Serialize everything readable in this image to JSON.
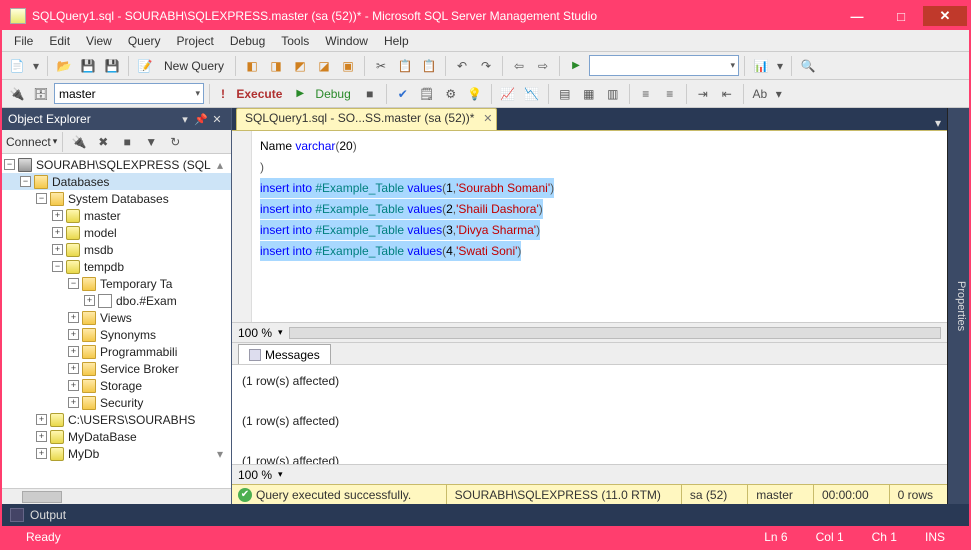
{
  "window": {
    "title": "SQLQuery1.sql - SOURABH\\SQLEXPRESS.master (sa (52))* - Microsoft SQL Server Management Studio"
  },
  "menu": [
    "File",
    "Edit",
    "View",
    "Query",
    "Project",
    "Debug",
    "Tools",
    "Window",
    "Help"
  ],
  "toolbar1": {
    "new_query": "New Query"
  },
  "toolbar2": {
    "db_selector": "master",
    "execute": "Execute",
    "debug": "Debug"
  },
  "object_explorer": {
    "title": "Object Explorer",
    "connect": "Connect",
    "nodes": {
      "server": "SOURABH\\SQLEXPRESS (SQL",
      "databases": "Databases",
      "system_db": "System Databases",
      "master": "master",
      "model": "model",
      "msdb": "msdb",
      "tempdb": "tempdb",
      "temp_tables": "Temporary Ta",
      "example": "dbo.#Exam",
      "views": "Views",
      "synonyms": "Synonyms",
      "programmability": "Programmabili",
      "service_broker": "Service Broker",
      "storage": "Storage",
      "security": "Security",
      "users_path": "C:\\USERS\\SOURABHS",
      "mydatabase": "MyDataBase",
      "mydb": "MyDb"
    }
  },
  "editor": {
    "tab_label": "SQLQuery1.sql - SO...SS.master (sa (52))*",
    "code": {
      "line1_a": "Name ",
      "line1_b": "varchar",
      "line1_c": "(",
      "line1_d": "20",
      "line1_e": ")",
      "line2": ")",
      "ins_kw": "insert into",
      "ins_tab": " #Example_Table ",
      "ins_values": "values",
      "row1_open": "(",
      "row1_n": "1",
      "row1_c": ",",
      "row1_s": "'Sourabh Somani'",
      "row1_close": ")",
      "row2_n": "2",
      "row2_s": "'Shaili Dashora'",
      "row3_n": "3",
      "row3_s": "'Divya Sharma'",
      "row4_n": "4",
      "row4_s": "'Swati Soni'"
    },
    "zoom": "100 %",
    "messages_tab": "Messages",
    "messages": [
      "(1 row(s) affected)",
      "(1 row(s) affected)",
      "(1 row(s) affected)"
    ],
    "status": {
      "text": "Query executed successfully.",
      "server": "SOURABH\\SQLEXPRESS (11.0 RTM)",
      "user": "sa (52)",
      "db": "master",
      "time": "00:00:00",
      "rows": "0 rows"
    }
  },
  "properties_tab": "Properties",
  "output_bar": "Output",
  "status_bar": {
    "ready": "Ready",
    "ln": "Ln 6",
    "col": "Col 1",
    "ch": "Ch 1",
    "ins": "INS"
  }
}
